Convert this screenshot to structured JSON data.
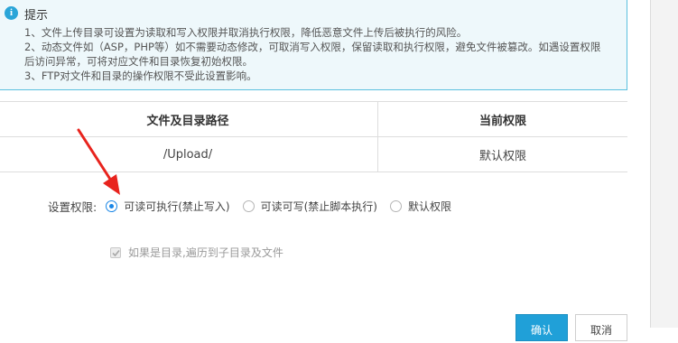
{
  "tip": {
    "icon": "info-icon",
    "title": "提示",
    "items": [
      "1、文件上传目录可设置为读取和写入权限并取消执行权限，降低恶意文件上传后被执行的风险。",
      "2、动态文件如（ASP，PHP等）如不需要动态修改，可取消写入权限，保留读取和执行权限，避免文件被篡改。如遇设置权限后访问异常，可将对应文件和目录恢复初始权限。",
      "3、FTP对文件和目录的操作权限不受此设置影响。"
    ]
  },
  "table": {
    "headers": [
      "文件及目录路径",
      "当前权限"
    ],
    "rows": [
      {
        "path": "/Upload/",
        "permission": "默认权限"
      }
    ]
  },
  "permission": {
    "label": "设置权限:",
    "options": [
      {
        "label": "可读可执行(禁止写入)",
        "selected": true
      },
      {
        "label": "可读可写(禁止脚本执行)",
        "selected": false
      },
      {
        "label": "默认权限",
        "selected": false
      }
    ]
  },
  "recursive": {
    "label": "如果是目录,遍历到子目录及文件",
    "checked": true,
    "disabled": true
  },
  "buttons": {
    "confirm": "确认",
    "cancel": "取消"
  },
  "colors": {
    "accent": "#20a0d8",
    "tip_border": "#5bc0de",
    "tip_background": "#eef8fb",
    "annotation_arrow": "#e8231d"
  }
}
